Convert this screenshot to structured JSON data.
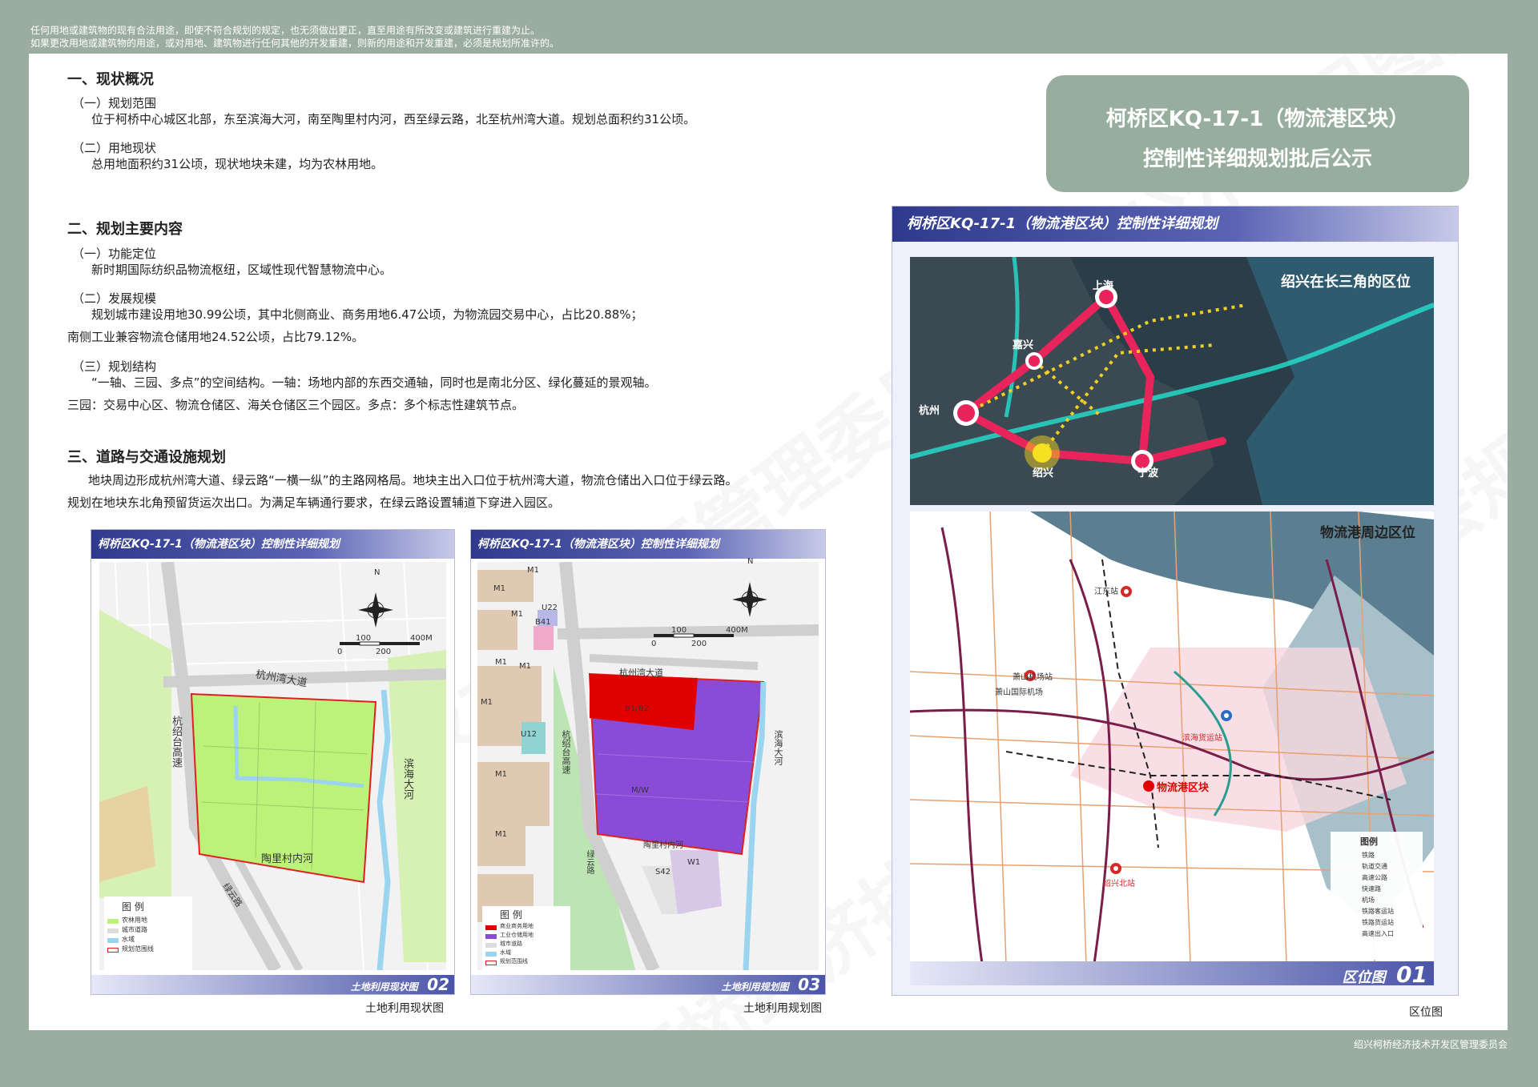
{
  "top_note": [
    "任何用地或建筑物的现有合法用途，即使不符合规划的规定，也无须做出更正，直至用途有所改变或建筑进行重建为止。",
    "如果更改用地或建筑物的用途，或对用地、建筑物进行任何其他的开发重建，则新的用途和开发重建，必须是规划所准许的。"
  ],
  "credit": "绍兴柯桥经济技术开发区管理委员会",
  "watermark": "柯桥经济技术开发区管理委员会规划公示专用图片",
  "title": {
    "line1": "柯桥区KQ-17-1（物流港区块）",
    "line2": "控制性详细规划批后公示"
  },
  "sections": {
    "s1": {
      "title": "一、现状概况",
      "sub1": "（一）规划范围",
      "p1": "位于柯桥中心城区北部，东至滨海大河，南至陶里村内河，西至绿云路，北至杭州湾大道。规划总面积约31公顷。",
      "sub2": "（二）用地现状",
      "p2": "总用地面积约31公顷，现状地块未建，均为农林用地。"
    },
    "s2": {
      "title": "二、规划主要内容",
      "sub1": "（一）功能定位",
      "p1": "新时期国际纺织品物流枢纽，区域性现代智慧物流中心。",
      "sub2": "（二）发展规模",
      "p2a": "规划城市建设用地30.99公顷，其中北侧商业、商务用地6.47公顷，为物流园交易中心，占比20.88%；",
      "p2b": "南侧工业兼容物流仓储用地24.52公顷，占比79.12%。",
      "sub3": "（三）规划结构",
      "p3a": "“一轴、三园、多点”的空间结构。一轴：场地内部的东西交通轴，同时也是南北分区、绿化蔓延的景观轴。",
      "p3b": "三园：交易中心区、物流仓储区、海关仓储区三个园区。多点：多个标志性建筑节点。"
    },
    "s3": {
      "title": "三、道路与交通设施规划",
      "p1": "地块周边形成杭州湾大道、绿云路“一横一纵”的主路网格局。地块主出入口位于杭州湾大道，物流仓储出入口位于绿云路。",
      "p2": "规划在地块东北角预留货运次出口。为满足车辆通行要求，在绿云路设置辅道下穿进入园区。"
    }
  },
  "panel_header": "柯桥区KQ-17-1（物流港区块）控制性详细规划",
  "map02": {
    "footer": "土地利用现状图",
    "num": "02",
    "caption": "土地利用现状图",
    "roads": {
      "north": "杭州湾大道",
      "west": "杭绍台高速",
      "east": "滨海大河",
      "south": "陶里村内河",
      "sw": "绿云路"
    },
    "scale": [
      "0",
      "100",
      "200",
      "400M"
    ],
    "north": "N",
    "legend_title": "图 例",
    "legend": [
      "农林用地",
      "城市道路",
      "水域",
      "规划范围线"
    ]
  },
  "map03": {
    "footer": "土地利用规划图",
    "num": "03",
    "caption": "土地利用规划图",
    "roads": {
      "north": "杭州湾大道",
      "west": "杭绍台高速",
      "east": "滨海大河",
      "south": "陶里村内河",
      "sw": "绿云路"
    },
    "zones": {
      "b": "B1/B2",
      "mw": "M/W"
    },
    "codes": [
      "M1",
      "M1",
      "M1",
      "M1",
      "M1",
      "M1",
      "M1",
      "M1",
      "B41",
      "U22",
      "U12",
      "S42",
      "W1"
    ],
    "scale": [
      "0",
      "100",
      "200",
      "400M"
    ],
    "north": "N",
    "legend_title": "图 例",
    "legend": [
      "商业商务用地",
      "工业仓储用地",
      "城市道路",
      "水域",
      "规划范围线"
    ]
  },
  "map01": {
    "footer": "区位图",
    "num": "01",
    "caption": "区位图",
    "top_title": "绍兴在长三角的区位",
    "cities": [
      "上海",
      "嘉兴",
      "杭州",
      "绍兴",
      "宁波"
    ],
    "bottom_title": "物流港周边区位",
    "site": "物流港区块",
    "stations": [
      "江东站",
      "萧山机场站",
      "萧山国际机场",
      "滨海货运站",
      "绍兴北站"
    ],
    "legend_title": "图例",
    "legend": [
      "铁路",
      "轨道交通",
      "高速公路",
      "快速路",
      "机场",
      "铁路客运站",
      "铁路货运站",
      "高速出入口"
    ]
  }
}
